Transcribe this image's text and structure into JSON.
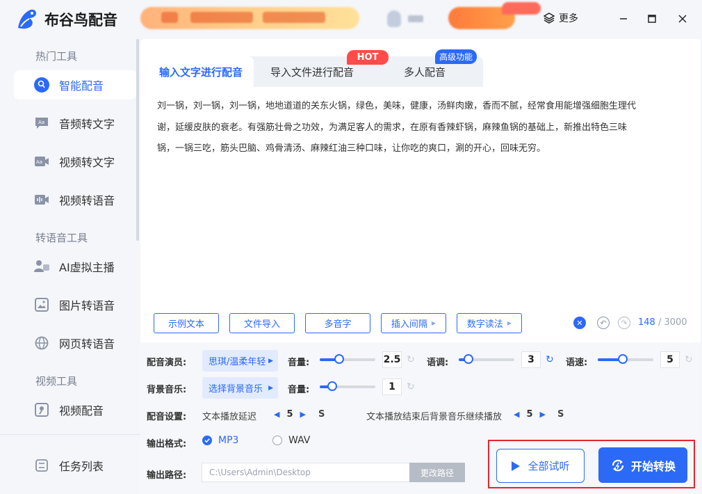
{
  "app": {
    "title": "布谷鸟配音",
    "more_label": "更多"
  },
  "sidebar": {
    "groups": [
      "热门工具",
      "转语音工具",
      "视频工具"
    ],
    "items": [
      {
        "label": "智能配音",
        "icon": "smart-dub-icon"
      },
      {
        "label": "音频转文字",
        "icon": "audio-to-text-icon"
      },
      {
        "label": "视频转文字",
        "icon": "video-to-text-icon"
      },
      {
        "label": "视频转语音",
        "icon": "video-to-voice-icon"
      },
      {
        "label": "AI虚拟主播",
        "icon": "ai-anchor-icon"
      },
      {
        "label": "图片转语音",
        "icon": "image-to-voice-icon"
      },
      {
        "label": "网页转语音",
        "icon": "web-to-voice-icon"
      },
      {
        "label": "视频配音",
        "icon": "video-dub-icon"
      }
    ],
    "task_list": "任务列表"
  },
  "tabs": [
    {
      "label": "输入文字进行配音"
    },
    {
      "label": "导入文件进行配音",
      "badge": "HOT"
    },
    {
      "label": "多人配音",
      "badge": "高级功能"
    }
  ],
  "content": {
    "line1": "刘一锅，刘一锅，刘一锅，地地道道的关东火锅，绿色，美味，健康，汤鲜肉嫩，香而不腻，经常食用能增强细胞生理代",
    "line2": "谢，延缓皮肤的衰老。有强筋壮骨之功效，为满足客人的需求，在原有香辣虾锅，麻辣鱼锅的基础上，新推出特色三味",
    "line3": "锅，一锅三吃，筋头巴脑、鸡骨清汤、麻辣红油三种口味，让你吃的爽口，涮的开心，回味无穷。"
  },
  "toolbar": {
    "buttons": [
      "示例文本",
      "文件导入",
      "多音字",
      "插入间隔",
      "数字读法"
    ],
    "count": "148",
    "max": "/ 3000"
  },
  "settings": {
    "voice_label": "配音演员:",
    "voice_value": "思琪/温柔年轻",
    "volume_label": "音量:",
    "voice_volume": "2.5",
    "pitch_label": "语调:",
    "pitch": "3",
    "speed_label": "语速:",
    "speed": "5",
    "bgm_label": "背景音乐:",
    "bgm_value": "选择背景音乐",
    "bgm_volume": "1",
    "config_label": "配音设置:",
    "delay_label": "文本播放延迟",
    "delay_value": "5",
    "delay_unit": "S",
    "tail_label": "文本播放结束后背景音乐继续播放",
    "tail_value": "5",
    "tail_unit": "S",
    "format_label": "输出格式:",
    "format_mp3": "MP3",
    "format_wav": "WAV",
    "path_label": "输出路径:",
    "path_value": "C:\\Users\\Admin\\Desktop",
    "path_button": "更改路径"
  },
  "actions": {
    "listen": "全部试听",
    "convert": "开始转换"
  },
  "sliders": {
    "voice_volume_fraction": 0.35,
    "pitch_fraction": 0.18,
    "speed_fraction": 0.45,
    "bgm_volume_fraction": 0.22
  },
  "colors": {
    "accent": "#2b6af7",
    "hot": "#ff4b4b",
    "highlight": "#e8242b"
  }
}
